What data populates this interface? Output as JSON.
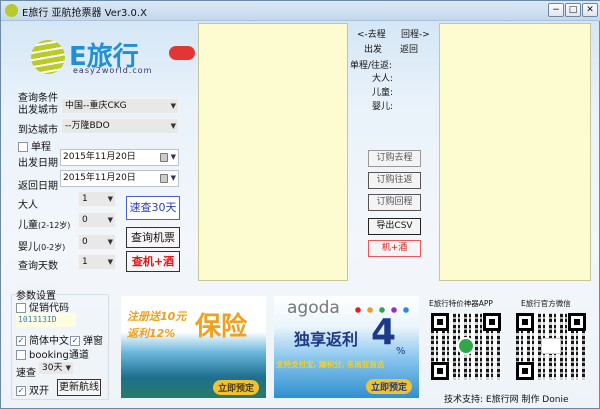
{
  "window": {
    "title": "E旅行 亚航抢票器  Ver3.0.X",
    "min": "−",
    "max": "□",
    "close": "✕"
  },
  "logo": {
    "brand": "E旅行",
    "url": "easy2world.com"
  },
  "query": {
    "group_label": "查询条件",
    "from_label": "出发城市",
    "from_value": "中国--重庆CKG",
    "to_label": "到达城市",
    "to_value": "--万隆BDO",
    "oneway_label": "单程",
    "oneway_checked": false,
    "depart_label": "出发日期",
    "depart_value": "2015年11月20日",
    "return_label": "返回日期",
    "return_value": "2015年11月20日",
    "adult_label": "大人",
    "adult_value": "1",
    "child_label": "儿童",
    "child_note": "(2-12岁)",
    "child_value": "0",
    "infant_label": "婴儿",
    "infant_note": "(0-2岁)",
    "infant_value": "0",
    "days_label": "查询天数",
    "days_value": "1",
    "quick30_label": "速查30天",
    "search_label": "查询机票",
    "hotel_label": "查机+酒"
  },
  "middle": {
    "prev": "<-去程",
    "next": "回程->",
    "depart": "出发",
    "return": "返回",
    "trip": "单程/往返:",
    "adult": "大人:",
    "child": "儿童:",
    "infant": "婴儿:",
    "buy_out": "订购去程",
    "buy_round": "订购往返",
    "buy_back": "订购回程",
    "export": "导出CSV",
    "hotel": "机+酒"
  },
  "params": {
    "group_label": "参数设置",
    "promo_label": "促销代码",
    "promo_checked": false,
    "promo_value": "101313ID",
    "simplified_label": "简体中文",
    "popup_label": "弹窗",
    "booking_label": "booking通道",
    "speed_label": "速查",
    "speed_value": "30天",
    "dual_label": "双开",
    "update_label": "更新航线"
  },
  "ads": {
    "ad1_line1": "注册送10元",
    "ad1_line2": "返利12%",
    "ad1_big": "保险",
    "ad1_btn": "立即预定",
    "ad2_brand": "agoda",
    "ad2_main": "独享返利",
    "ad2_num": "4",
    "ad2_pct": "%",
    "ad2_sub": "支持支付宝, 赚积分, 东南亚首选",
    "ad2_btn": "立即预定"
  },
  "qr": {
    "app_label": "E旅行特价神器APP",
    "wechat_label": "E旅行官方微信"
  },
  "footer": {
    "credit": "技术支持: E旅行网 制作 Donie"
  },
  "colors": {
    "blue_btn": "#2a3fbf",
    "red_btn": "#e01818",
    "yellow_panel": "#fdfbd0"
  }
}
